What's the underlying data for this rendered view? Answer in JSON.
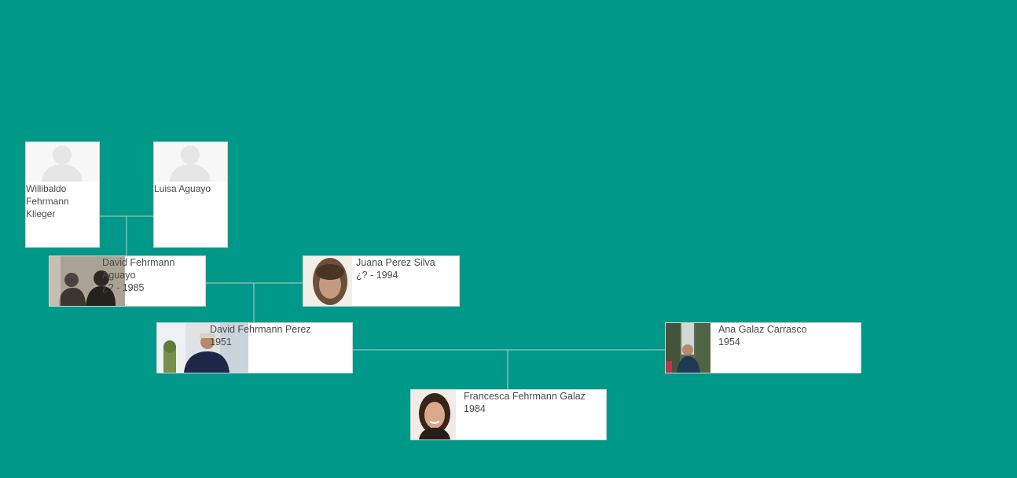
{
  "tree": {
    "people": {
      "willibaldo": {
        "name": "Willibaldo Fehrmann Klieger",
        "dates": "",
        "photo": "silhouette-icon"
      },
      "luisa": {
        "name": "Luisa Aguayo",
        "dates": "",
        "photo": "silhouette-icon"
      },
      "david_sr": {
        "name": "David Fehrmann Aguayo",
        "dates": "¿? - 1985",
        "photo": "portrait-photo"
      },
      "juana": {
        "name": "Juana Perez Silva",
        "dates": "¿? - 1994",
        "photo": "portrait-photo"
      },
      "david_jr": {
        "name": "David Fehrmann Perez",
        "dates": "1951",
        "photo": "portrait-photo"
      },
      "ana": {
        "name": "Ana Galaz Carrasco",
        "dates": "1954",
        "photo": "portrait-photo"
      },
      "francesca": {
        "name": "Francesca Fehrmann Galaz",
        "dates": "1984",
        "photo": "portrait-photo"
      }
    }
  },
  "colors": {
    "background": "#009889",
    "card": "#ffffff",
    "connector": "#c8c8c8",
    "text": "#4a4a4a"
  }
}
